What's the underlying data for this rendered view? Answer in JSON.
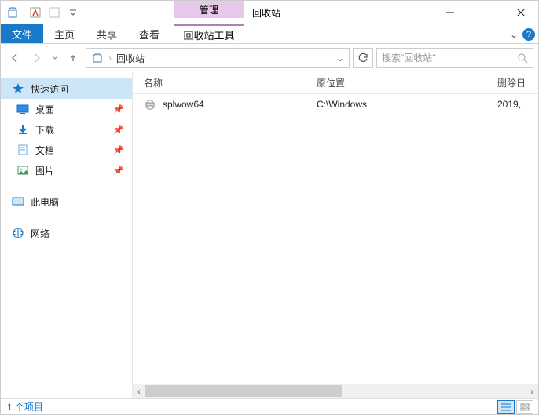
{
  "titlebar": {
    "contextual_label": "管理",
    "window_title": "回收站"
  },
  "ribbon": {
    "file": "文件",
    "tabs": [
      "主页",
      "共享",
      "查看"
    ],
    "context_tab": "回收站工具"
  },
  "address": {
    "location": "回收站",
    "search_placeholder": "搜索\"回收站\""
  },
  "sidebar": {
    "quick_access": "快速访问",
    "items": [
      {
        "label": "桌面",
        "pinned": true
      },
      {
        "label": "下载",
        "pinned": true
      },
      {
        "label": "文档",
        "pinned": true
      },
      {
        "label": "图片",
        "pinned": true
      }
    ],
    "this_pc": "此电脑",
    "network": "网络"
  },
  "columns": {
    "name": "名称",
    "original_location": "原位置",
    "date_deleted": "删除日"
  },
  "rows": [
    {
      "name": "splwow64",
      "location": "C:\\Windows",
      "date": "2019,"
    }
  ],
  "status": {
    "item_count": "1 个项目"
  },
  "colors": {
    "accent": "#1979ca",
    "contextual": "#e8c8e8"
  }
}
